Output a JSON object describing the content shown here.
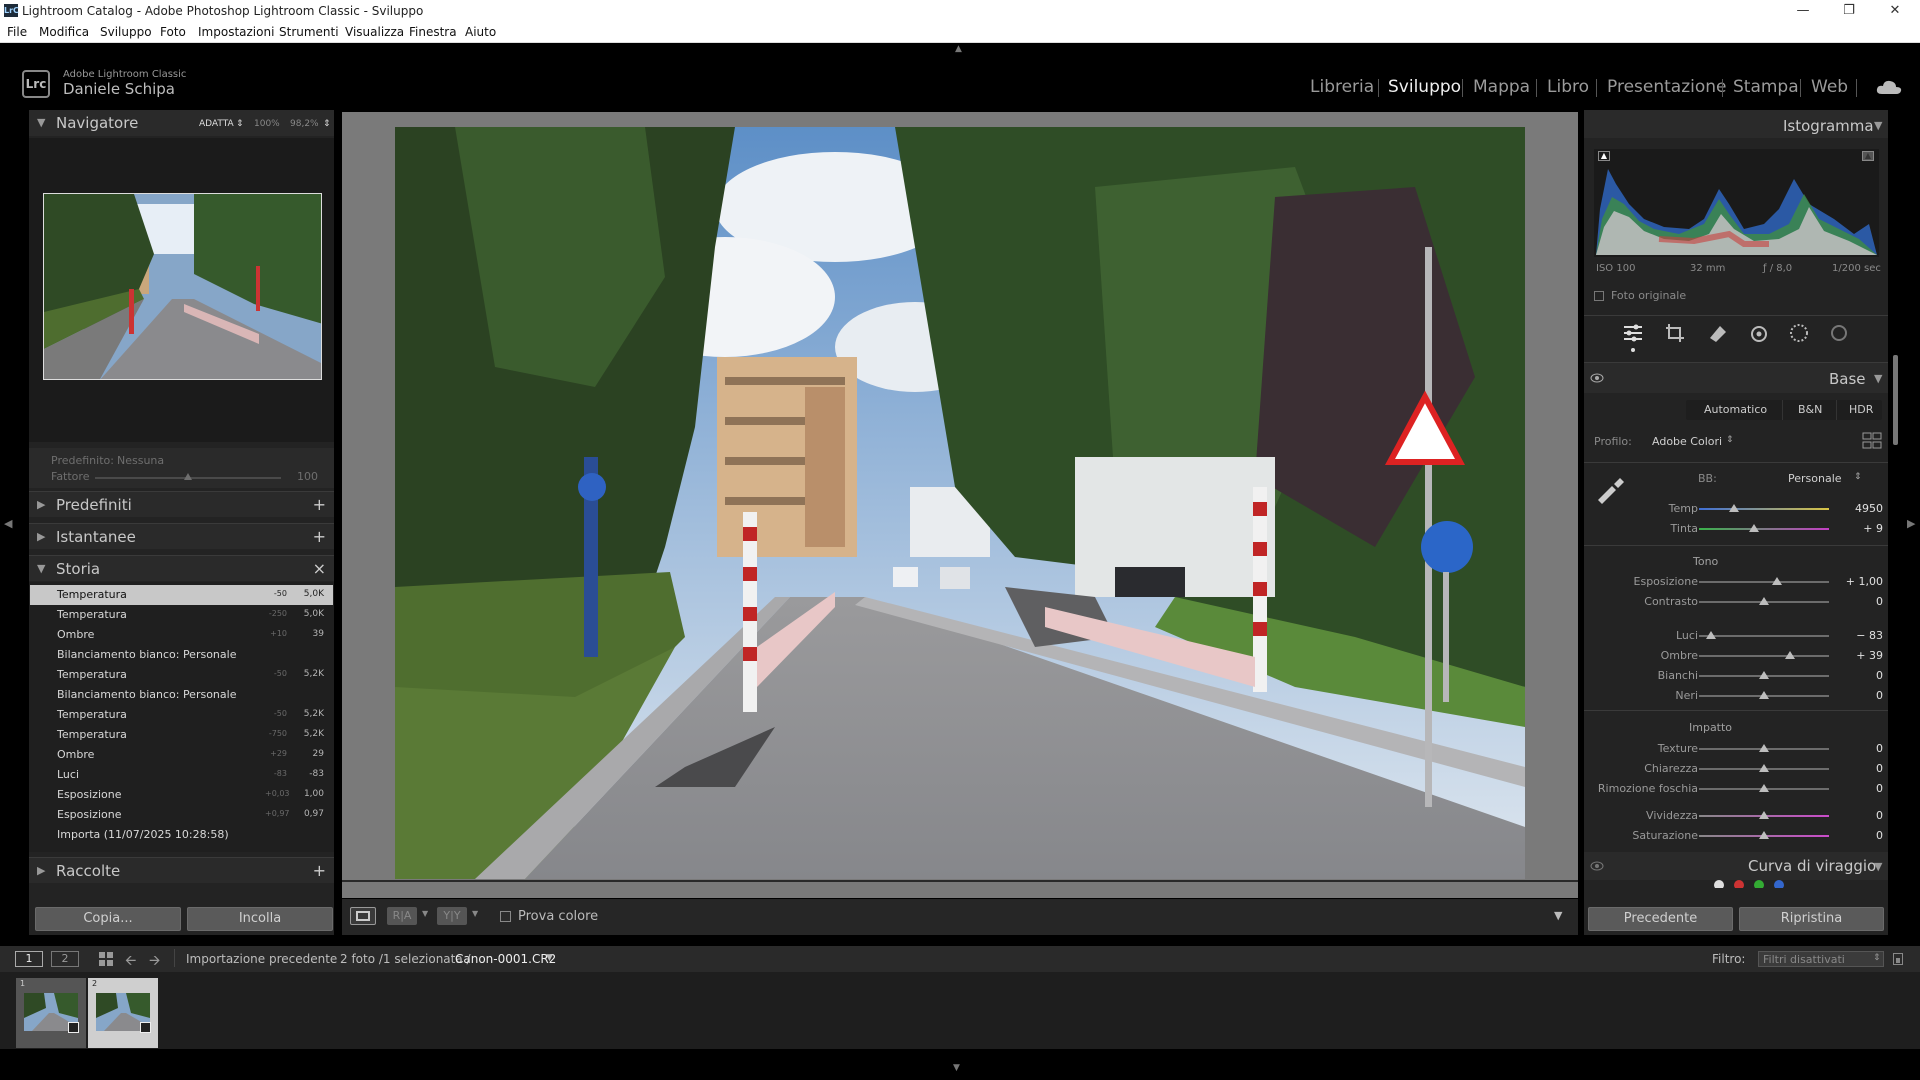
{
  "window": {
    "title": "Lightroom Catalog - Adobe Photoshop Lightroom Classic - Sviluppo",
    "lrc_badge": "LrC"
  },
  "menu": [
    "File",
    "Modifica",
    "Sviluppo",
    "Foto",
    "Impostazioni",
    "Strumenti",
    "Visualizza",
    "Finestra",
    "Aiuto"
  ],
  "brand": {
    "product": "Adobe Lightroom Classic",
    "user": "Daniele Schipa",
    "logo": "Lrc"
  },
  "modules": [
    "Libreria",
    "Sviluppo",
    "Mappa",
    "Libro",
    "Presentazione",
    "Stampa",
    "Web"
  ],
  "active_module": "Sviluppo",
  "navigator": {
    "title": "Navigatore",
    "zoom_fit": "ADATTA",
    "zoom_100": "100%",
    "zoom_custom": "98,2%"
  },
  "preset_amount": {
    "label": "Predefinito:",
    "value": "Nessuna",
    "factor_label": "Fattore",
    "factor_value": "100",
    "factor_level": 0.5
  },
  "left_sections": {
    "presets": "Predefiniti",
    "snapshots": "Istantanee",
    "history": "Storia",
    "collections": "Raccolte",
    "plus": "+",
    "close": "×"
  },
  "history": [
    {
      "name": "Temperatura",
      "delta": "-50",
      "value": "5,0K",
      "selected": true
    },
    {
      "name": "Temperatura",
      "delta": "-250",
      "value": "5,0K"
    },
    {
      "name": "Ombre",
      "delta": "+10",
      "value": "39"
    },
    {
      "name": "Bilanciamento bianco: Personale",
      "delta": "",
      "value": ""
    },
    {
      "name": "Temperatura",
      "delta": "-50",
      "value": "5,2K"
    },
    {
      "name": "Bilanciamento bianco: Personale",
      "delta": "",
      "value": ""
    },
    {
      "name": "Temperatura",
      "delta": "-50",
      "value": "5,2K"
    },
    {
      "name": "Temperatura",
      "delta": "-750",
      "value": "5,2K"
    },
    {
      "name": "Ombre",
      "delta": "+29",
      "value": "29"
    },
    {
      "name": "Luci",
      "delta": "-83",
      "value": "-83"
    },
    {
      "name": "Esposizione",
      "delta": "+0,03",
      "value": "1,00"
    },
    {
      "name": "Esposizione",
      "delta": "+0,97",
      "value": "0,97"
    },
    {
      "name": "Importa (11/07/2025 10:28:58)",
      "delta": "",
      "value": ""
    }
  ],
  "left_buttons": {
    "copy": "Copia...",
    "paste": "Incolla"
  },
  "toolbar": {
    "soft_proof": "Prova colore",
    "view_ra": "R|A",
    "view_yy": "Y|Y"
  },
  "histogram": {
    "title": "Istogramma",
    "iso": "ISO 100",
    "focal": "32 mm",
    "aperture": "ƒ / 8,0",
    "shutter": "1/200 sec",
    "original_photo": "Foto originale"
  },
  "base": {
    "title": "Base",
    "treatment": [
      "Automatico",
      "B&N",
      "HDR"
    ],
    "profile_label": "Profilo:",
    "profile_value": "Adobe Colori",
    "wb_label": "BB:",
    "wb_value": "Personale",
    "tone_label": "Tono",
    "presence_label": "Impatto",
    "sliders": {
      "temp": {
        "name": "Temp",
        "value": "4950",
        "level": 0.27
      },
      "tint": {
        "name": "Tinta",
        "value": "+ 9",
        "level": 0.42
      },
      "exposure": {
        "name": "Esposizione",
        "value": "+ 1,00",
        "level": 0.6
      },
      "contrast": {
        "name": "Contrasto",
        "value": "0",
        "level": 0.5
      },
      "highlights": {
        "name": "Luci",
        "value": "− 83",
        "level": 0.09
      },
      "shadows": {
        "name": "Ombre",
        "value": "+ 39",
        "level": 0.7
      },
      "whites": {
        "name": "Bianchi",
        "value": "0",
        "level": 0.5
      },
      "blacks": {
        "name": "Neri",
        "value": "0",
        "level": 0.5
      },
      "texture": {
        "name": "Texture",
        "value": "0",
        "level": 0.5
      },
      "clarity": {
        "name": "Chiarezza",
        "value": "0",
        "level": 0.5
      },
      "dehaze": {
        "name": "Rimozione foschia",
        "value": "0",
        "level": 0.5
      },
      "vibrance": {
        "name": "Vividezza",
        "value": "0",
        "level": 0.5
      },
      "saturation": {
        "name": "Saturazione",
        "value": "0",
        "level": 0.5
      }
    }
  },
  "tone_curve": {
    "title": "Curva di viraggio"
  },
  "right_buttons": {
    "previous": "Precedente",
    "reset": "Ripristina"
  },
  "filmstrip": {
    "page1": "1",
    "page2": "2",
    "source": "Importazione precedente",
    "count": "2 foto /1 selezionata /",
    "filename": "Canon-0001.CR2",
    "filter_label": "Filtro:",
    "filter_value": "Filtri disattivati",
    "thumb1_num": "1",
    "thumb2_num": "2"
  }
}
